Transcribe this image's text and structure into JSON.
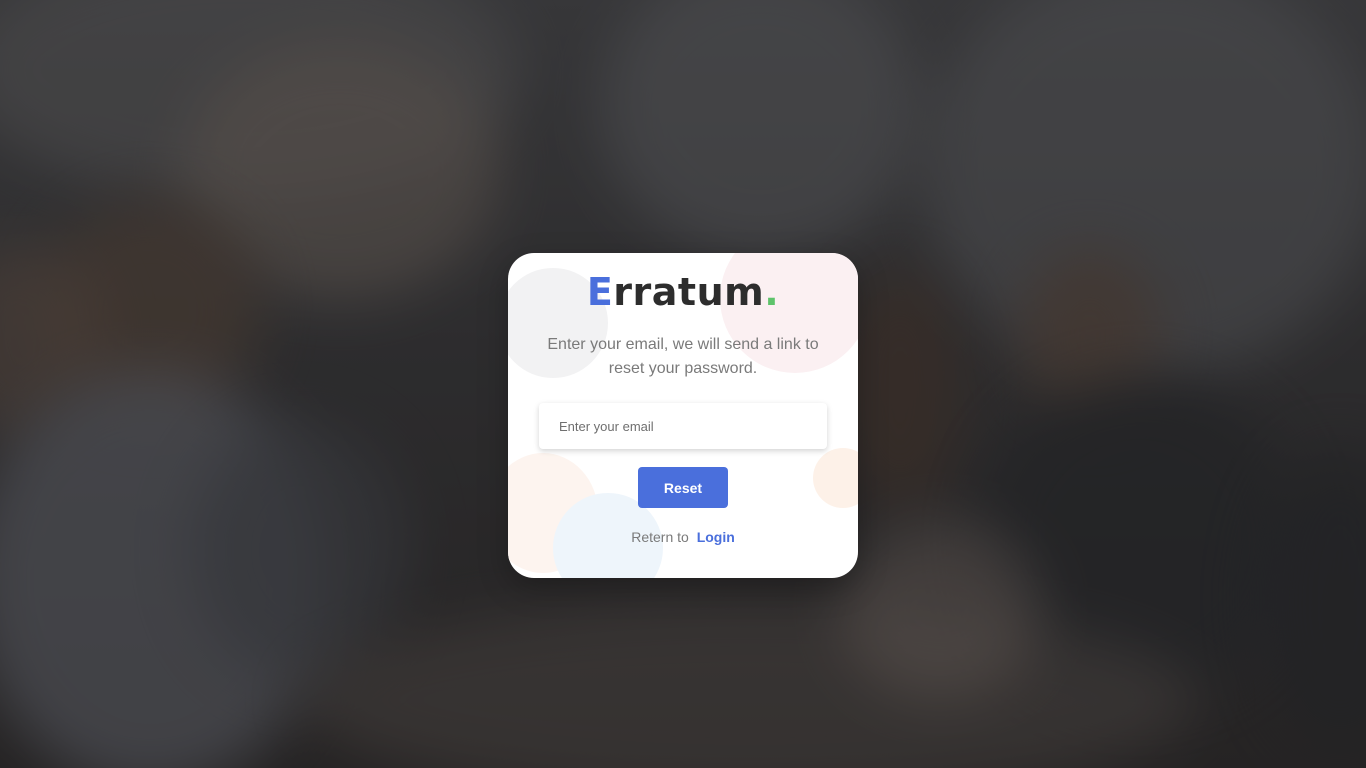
{
  "brand": {
    "logo_first": "E",
    "logo_rest": "rratum",
    "logo_dot": ".",
    "accent_color": "#4a6fdc",
    "dot_color": "#5ec36b"
  },
  "reset_form": {
    "instructions": "Enter your email, we will send a link to reset your password.",
    "email_placeholder": "Enter your email",
    "email_value": "",
    "reset_label": "Reset",
    "footer_text": "Retern to",
    "login_label": "Login"
  }
}
